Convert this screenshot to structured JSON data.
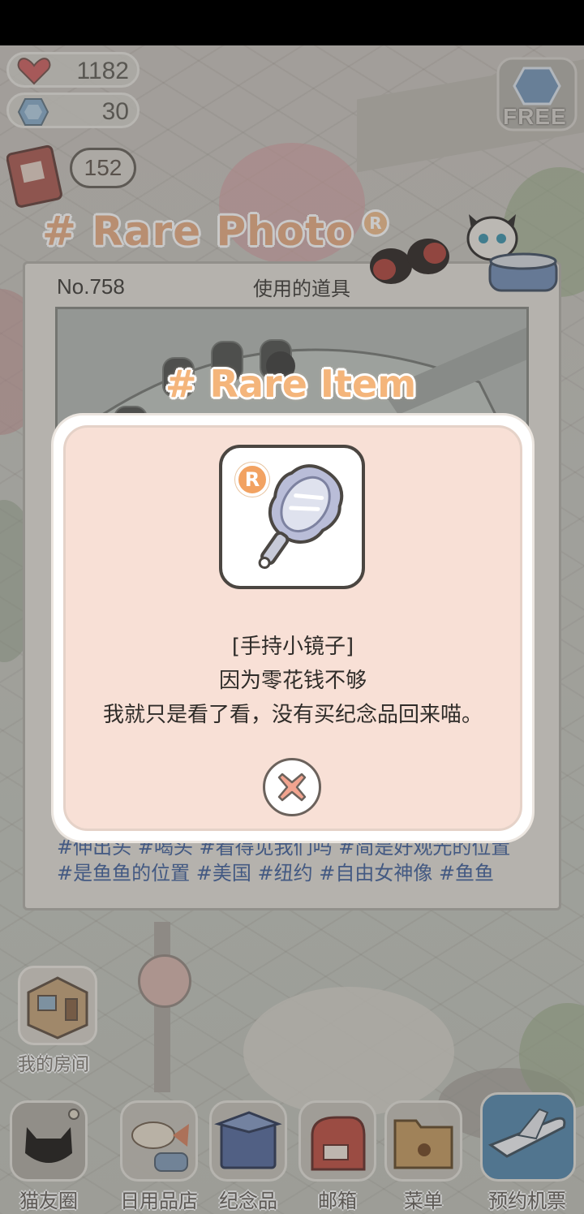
{
  "hud": {
    "hearts": "1182",
    "gems": "30",
    "messages": "152",
    "free_label": "FREE"
  },
  "photo": {
    "title": "# Rare Photo",
    "number": "No.758",
    "used_items_label": "使用的道具",
    "tags_line1": "#伸出头 #喝头 #看得见我们吗 #简是好观光的位置",
    "tags_line2": "#是鱼鱼的位置 #美国 #纽约 #自由女神像 #鱼鱼"
  },
  "popup": {
    "header": "# Rare Item",
    "rarity": "R",
    "item_name": "[手持小镜子]",
    "line2": "因为零花钱不够",
    "line3": "我就只是看了看，没有买纪念品回来喵。"
  },
  "room_label": "我的房间",
  "nav": [
    {
      "label": "猫友圈"
    },
    {
      "label": "日用品店"
    },
    {
      "label": "纪念品"
    },
    {
      "label": "邮箱"
    },
    {
      "label": "菜单"
    },
    {
      "label": "预约机票"
    }
  ],
  "colors": {
    "popup_bg": "#f8e0d6",
    "accent_orange": "#f4b57b",
    "tag_blue": "#4d6aa0"
  }
}
